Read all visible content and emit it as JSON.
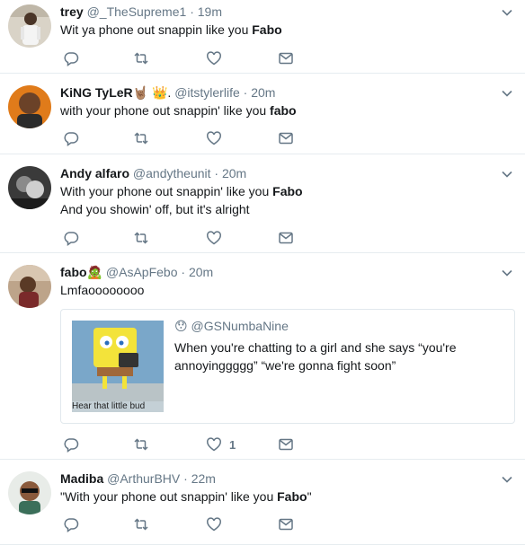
{
  "tweets": [
    {
      "name": "trey",
      "handle": "@_TheSupreme1",
      "dot": "·",
      "time": "19m",
      "text_plain": "Wit ya phone out snappin like you",
      "text_bold": "Fabo",
      "text_tail": "",
      "text2": ""
    },
    {
      "name": "KiNG TyLeR",
      "name_emoji": "🤘🏽 👑.",
      "handle": "@itstylerlife",
      "dot": "·",
      "time": "20m",
      "text_plain": "with your phone out snappin' like you",
      "text_bold": "fabo",
      "text_tail": "",
      "text2": ""
    },
    {
      "name": "Andy alfaro",
      "handle": "@andytheunit",
      "dot": "·",
      "time": "20m",
      "text_plain": "With your phone out snappin' like you",
      "text_bold": "Fabo",
      "text_tail": "",
      "text2": "And you showin' off, but it's alright"
    },
    {
      "name": "fabo",
      "name_emoji": "🧟",
      "handle": "@AsApFebo",
      "dot": "·",
      "time": "20m",
      "text_plain": "Lmfaoooooooo",
      "text_bold": "",
      "text_tail": "",
      "text2": "",
      "like_count": "1",
      "quote": {
        "emoji": "😯",
        "handle": "@GSNumbaNine",
        "text": "When you're chatting to a girl and she says “you're annoyinggggg” “we're gonna fight soon”",
        "image_caption": "Hear that little bud"
      }
    },
    {
      "name": "Madiba",
      "handle": "@ArthurBHV",
      "dot": "·",
      "time": "22m",
      "text_plain": "\"With your phone out snappin' like you",
      "text_bold": "Fabo",
      "text_tail": "\"",
      "text2": ""
    }
  ],
  "colors": {
    "text": "#14171a",
    "muted": "#657786",
    "divider": "#e6ecf0",
    "icon": "#657786"
  },
  "icons": [
    "reply-icon",
    "retweet-icon",
    "like-icon",
    "direct-message-icon",
    "chevron-down-icon"
  ]
}
